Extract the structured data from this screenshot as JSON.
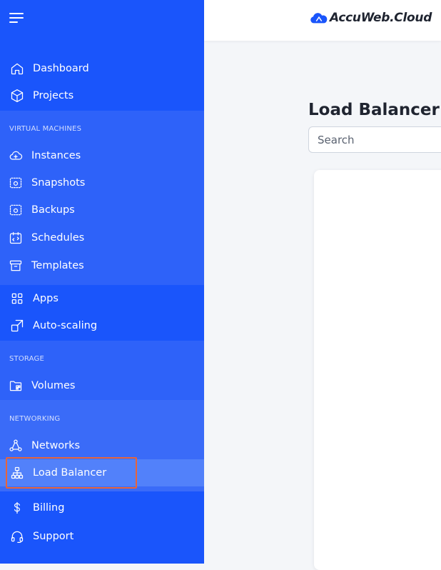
{
  "brand": {
    "name": "AccuWeb.Cloud"
  },
  "sidebar": {
    "top_items": [
      {
        "label": "Dashboard"
      },
      {
        "label": "Projects"
      }
    ],
    "virtual_machines": {
      "heading": "VIRTUAL MACHINES",
      "items": [
        {
          "label": "Instances"
        },
        {
          "label": "Snapshots"
        },
        {
          "label": "Backups"
        },
        {
          "label": "Schedules"
        },
        {
          "label": "Templates"
        }
      ]
    },
    "apps_items": [
      {
        "label": "Apps"
      },
      {
        "label": "Auto-scaling"
      }
    ],
    "storage": {
      "heading": "STORAGE",
      "items": [
        {
          "label": "Volumes"
        }
      ]
    },
    "networking": {
      "heading": "NETWORKING",
      "items": [
        {
          "label": "Networks"
        },
        {
          "label": "Load Balancer",
          "active": true
        }
      ]
    },
    "bottom_items": [
      {
        "label": "Billing"
      },
      {
        "label": "Support"
      }
    ]
  },
  "main": {
    "title": "Load Balancer",
    "search": {
      "placeholder": "Search",
      "value": ""
    }
  },
  "colors": {
    "sidebar": "#1a55fb",
    "sidebar_section": "#2e62f9",
    "active_item": "#5281fa",
    "highlight": "#e8643a"
  }
}
